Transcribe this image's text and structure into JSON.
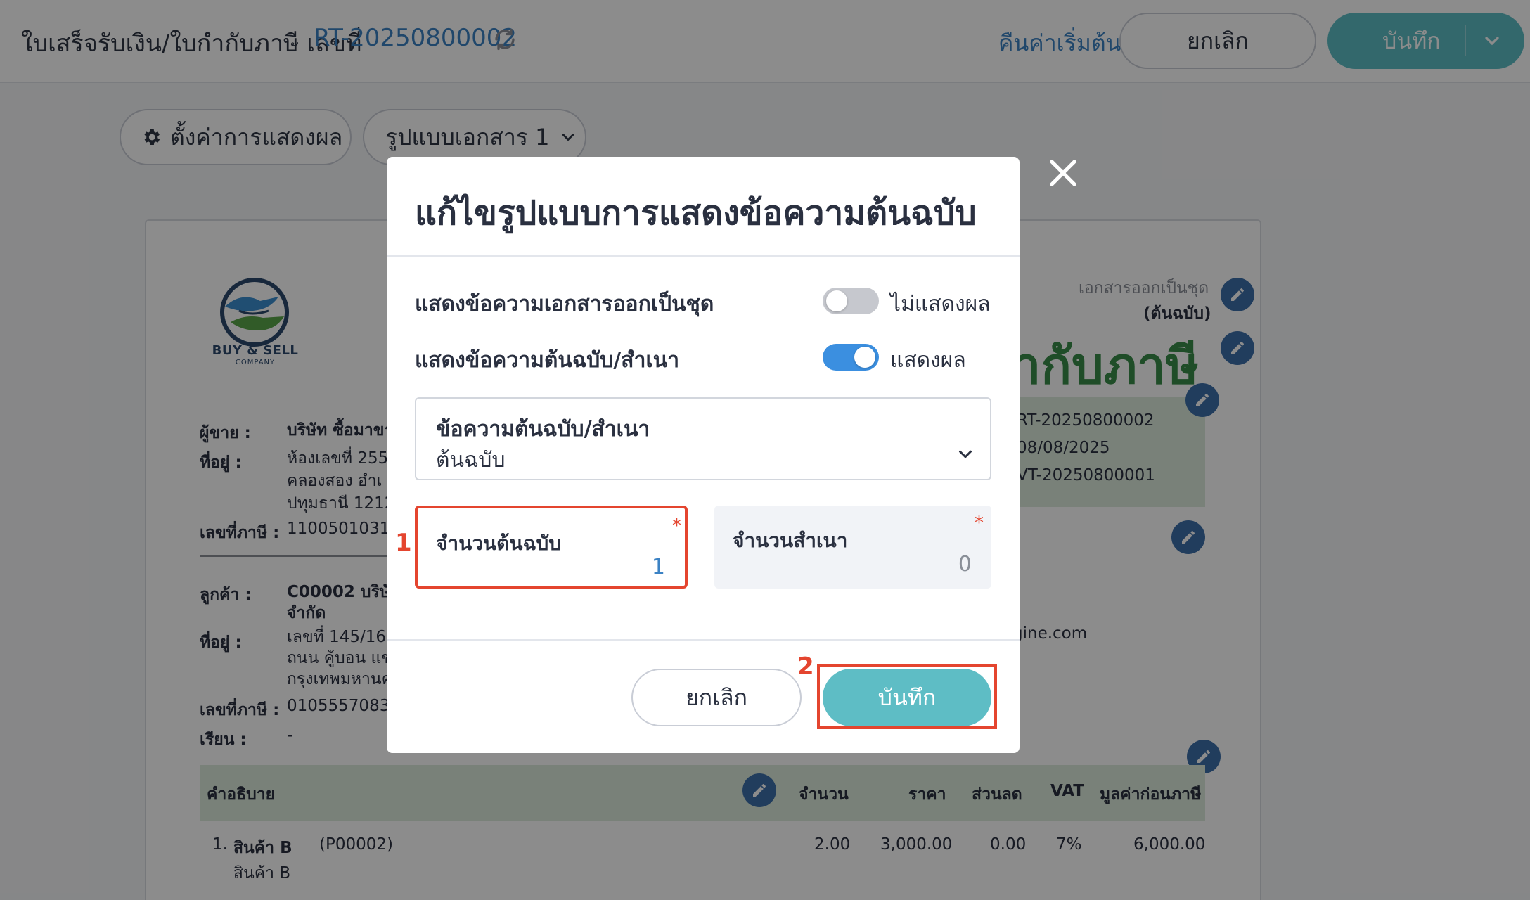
{
  "header": {
    "doc_type": "ใบเสร็จรับเงิน/ใบกำกับภาษี เลขที่",
    "doc_number": "RT-20250800002",
    "reset_label": "คืนค่าเริ่มต้น",
    "cancel_label": "ยกเลิก",
    "save_label": "บันทึก"
  },
  "toolbar": {
    "settings_label": "ตั้งค่าการแสดงผล",
    "format_label": "รูปแบบเอกสาร 1"
  },
  "document": {
    "logo_text": "BUY & SELL",
    "logo_sub": "COMPANY",
    "seller_label": "ผู้ขาย :",
    "seller_value": "บริษัท ซื้อมาขา",
    "address_label": "ที่อยู่ :",
    "address_line1": "ห้องเลขที่ 255",
    "address_line2": "คลองสอง อำเ",
    "address_line3": "ปทุมธานี 1212",
    "tax_label": "เลขที่ภาษี :",
    "tax_value": "11005010315",
    "customer_label": "ลูกค้า :",
    "customer_line1": "C00002 บริษัท",
    "customer_line2": "จำกัด",
    "cust_address_label": "ที่อยู่ :",
    "cust_address_line1": "เลขที่ 145/161",
    "cust_address_line2": "ถนน คู้บอน  แข",
    "cust_address_line3": "กรุงเทพมหานค",
    "cust_tax_label": "เลขที่ภาษี :",
    "cust_tax_value": "01055570833",
    "attn_label": "เรียน :",
    "attn_value": "-",
    "copy_note": "เอกสารออกเป็นชุด",
    "copy_note2": "(ต้นฉบับ)",
    "big_title": "ำกับภาษี",
    "meta1": "RT-20250800002",
    "meta2": "08/08/2025",
    "meta3": "VT-20250800001",
    "email": "gine.com",
    "table": {
      "headers": [
        "คำอธิบาย",
        "จำนวน",
        "ราคา",
        "ส่วนลด",
        "VAT",
        "มูลค่าก่อนภาษี"
      ],
      "row": {
        "index": "1.",
        "name": "สินค้า B",
        "code": "(P00002)",
        "desc": "สินค้า B",
        "qty": "2.00",
        "price": "3,000.00",
        "discount": "0.00",
        "vat": "7%",
        "amount": "6,000.00"
      }
    }
  },
  "modal": {
    "title": "แก้ไขรูปแบบการแสดงข้อความต้นฉบับ",
    "row1_label": "แสดงข้อความเอกสารออกเป็นชุด",
    "row1_state": "ไม่แสดงผล",
    "row2_label": "แสดงข้อความต้นฉบับ/สำเนา",
    "row2_state": "แสดงผล",
    "select_label": "ข้อความต้นฉบับ/สำเนา",
    "select_value": "ต้นฉบับ",
    "orig_label": "จำนวนต้นฉบับ",
    "orig_value": "1",
    "copy_label": "จำนวนสำเนา",
    "copy_value": "0",
    "required_mark": "*",
    "cancel_label": "ยกเลิก",
    "save_label": "บันทึก"
  },
  "annotations": {
    "step1": "1",
    "step2": "2"
  },
  "colors": {
    "accent_teal": "#5ebdc5",
    "link_blue": "#3b82c4",
    "toggle_on": "#3b8fe0",
    "highlight_red": "#e4452f",
    "title_green": "#3a8c4a"
  }
}
